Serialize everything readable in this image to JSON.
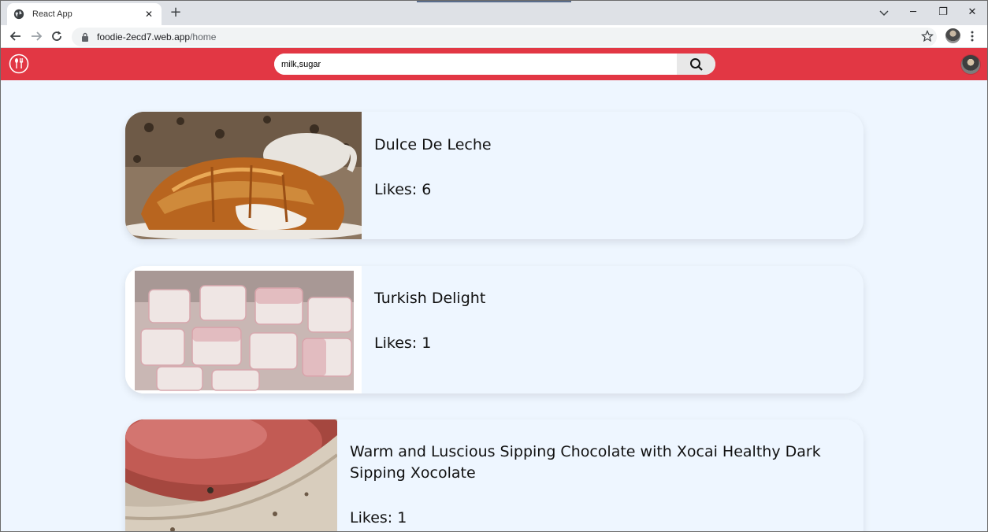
{
  "browser": {
    "tab_title": "React App",
    "url_host": "foodie-2ecd7.web.app",
    "url_path": "/home"
  },
  "header": {
    "search_value": "milk,sugar",
    "accent_color": "#e23744"
  },
  "recipes": [
    {
      "name": "Dulce De Leche",
      "likes": "Likes: 6"
    },
    {
      "name": "Turkish Delight",
      "likes": "Likes: 1"
    },
    {
      "name": "Warm and Luscious Sipping Chocolate with Xocai Healthy Dark Sipping Xocolate",
      "likes": "Likes: 1"
    }
  ],
  "icons": {
    "tab_favicon": "globe-icon",
    "back": "arrow-left-icon",
    "forward": "arrow-right-icon",
    "reload": "reload-icon",
    "lock": "lock-icon",
    "bookmark": "star-icon",
    "menu": "kebab-icon",
    "logo": "fork-spoon-logo-icon",
    "search": "search-icon"
  }
}
